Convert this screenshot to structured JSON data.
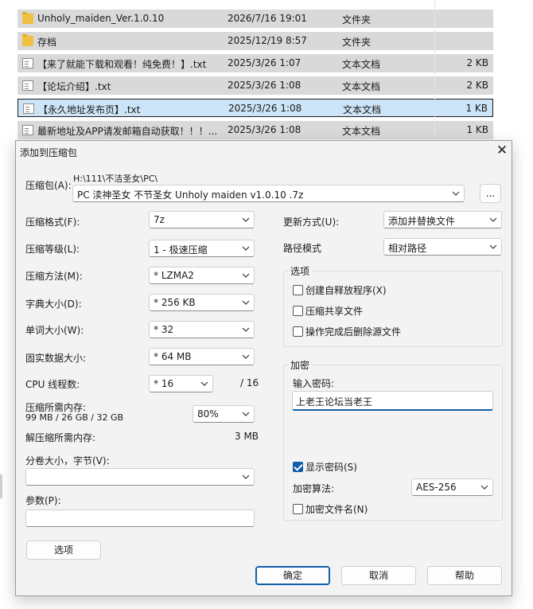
{
  "files": [
    {
      "name": "Unholy_maiden_Ver.1.0.10",
      "date": "2026/7/16 19:01",
      "type": "文件夹",
      "size": "",
      "icon": "folder-icon"
    },
    {
      "name": "存档",
      "date": "2025/12/19 8:57",
      "type": "文件夹",
      "size": "",
      "icon": "folder-icon"
    },
    {
      "name": "【来了就能下载和观看！纯免费！】.txt",
      "date": "2025/3/26 1:07",
      "type": "文本文档",
      "size": "2 KB",
      "icon": "text-file-icon"
    },
    {
      "name": "【论坛介绍】.txt",
      "date": "2025/3/26 1:08",
      "type": "文本文档",
      "size": "2 KB",
      "icon": "text-file-icon"
    },
    {
      "name": "【永久地址发布页】.txt",
      "date": "2025/3/26 1:08",
      "type": "文本文档",
      "size": "1 KB",
      "icon": "text-file-icon"
    },
    {
      "name": "最新地址及APP请发邮箱自动获取！！！...",
      "date": "2025/3/26 1:08",
      "type": "文本文档",
      "size": "1 KB",
      "icon": "text-file-icon"
    }
  ],
  "dialog": {
    "title": "添加到压缩包",
    "close": "✕",
    "archive": {
      "label": "压缩包(A):",
      "path": "H:\\111\\不洁圣女\\PC\\",
      "filename": "PC 渎神圣女 不节圣女 Unholy maiden v1.0.10 .7z",
      "browse": "..."
    },
    "format": {
      "label": "压缩格式(F):",
      "value": "7z"
    },
    "level": {
      "label": "压缩等级(L):",
      "value": "1 - 极速压缩"
    },
    "method": {
      "label": "压缩方法(M):",
      "value": "* LZMA2"
    },
    "dict": {
      "label": "字典大小(D):",
      "value": "* 256 KB"
    },
    "word": {
      "label": "单词大小(W):",
      "value": "* 32"
    },
    "solid": {
      "label": "固实数据大小:",
      "value": "* 64 MB"
    },
    "threads": {
      "label": "CPU 线程数:",
      "value": "* 16",
      "max": "/ 16"
    },
    "memory": {
      "label": "压缩所需内存:",
      "detail": "99 MB / 26 GB / 32 GB",
      "value": "80%"
    },
    "decompress": {
      "label": "解压缩所需内存:",
      "value": "3 MB"
    },
    "volume": {
      "label": "分卷大小，字节(V):",
      "value": ""
    },
    "params": {
      "label": "参数(P):",
      "value": ""
    },
    "options_btn": "选项",
    "update": {
      "label": "更新方式(U):",
      "value": "添加并替换文件"
    },
    "pathmode": {
      "label": "路径模式",
      "value": "相对路径"
    },
    "options": {
      "title": "选项",
      "items": [
        {
          "label": "创建自释放程序(X)",
          "checked": false
        },
        {
          "label": "压缩共享文件",
          "checked": false
        },
        {
          "label": "操作完成后删除源文件",
          "checked": false
        }
      ]
    },
    "encryption": {
      "title": "加密",
      "password_label": "输入密码:",
      "password": "上老王论坛当老王",
      "show_password": "显示密码(S)",
      "show_checked": true,
      "method_label": "加密算法:",
      "method": "AES-256",
      "encrypt_names": "加密文件名(N)",
      "encrypt_names_checked": false
    },
    "buttons": {
      "ok": "确定",
      "cancel": "取消",
      "help": "帮助"
    }
  }
}
